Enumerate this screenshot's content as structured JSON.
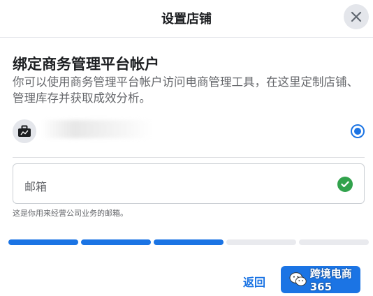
{
  "header": {
    "title": "设置店铺"
  },
  "section": {
    "title": "绑定商务管理平台帐户",
    "description": "你可以使用商务管理平台帐户访问电商管理工具，在这里定制店铺、管理库存并获取成效分析。"
  },
  "account": {
    "selected": true
  },
  "email": {
    "label": "邮箱",
    "helper": "这是你用来经营公司业务的邮箱。",
    "verified": true
  },
  "progress": {
    "total_steps": 5,
    "completed_steps": 3
  },
  "footer": {
    "back_label": "返回",
    "watermark": "跨境电商365"
  },
  "colors": {
    "accent": "#1b74e4",
    "success": "#31a24c"
  }
}
